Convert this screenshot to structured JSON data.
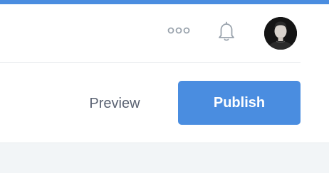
{
  "header": {
    "accent_color": "#4a8de0",
    "more_icon": "more-horizontal-icon",
    "notifications_icon": "bell-icon",
    "avatar_icon": "user-avatar"
  },
  "actions": {
    "preview_label": "Preview",
    "publish_label": "Publish",
    "publish_color": "#4a8de0",
    "preview_text_color": "#5a6272"
  },
  "content": {
    "background_color": "#f2f5f7"
  }
}
